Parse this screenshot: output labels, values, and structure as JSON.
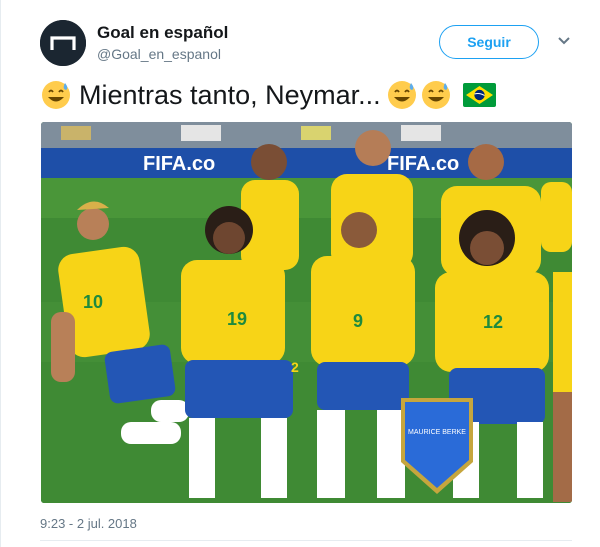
{
  "account": {
    "name": "Goal en español",
    "handle": "@Goal_en_espanol",
    "avatar_icon": "goal-logo-icon"
  },
  "actions": {
    "follow_label": "Seguir",
    "more_icon": "chevron-down-icon"
  },
  "tweet": {
    "text": "Mientras tanto, Neymar...",
    "emojis": [
      "sweat-smile-emoji",
      "sweat-smile-emoji",
      "sweat-smile-emoji",
      "brazil-flag-emoji"
    ],
    "timestamp": "9:23 - 2 jul. 2018"
  },
  "media": {
    "description_icon": "team-photo-image",
    "banner_text_left": "FIFA.co",
    "banner_text_right": "FIFA.co",
    "pennant_text": "MAURICE BERKE",
    "jersey_numbers": [
      "10",
      "19",
      "9",
      "2",
      "12"
    ],
    "colors": {
      "jersey": "#f7d417",
      "shorts": "#2356b5",
      "pitch": "#3f8a34",
      "banner": "#1e4fa8"
    }
  },
  "colors": {
    "accent": "#1da1f2",
    "text": "#14171a",
    "muted": "#657786"
  }
}
